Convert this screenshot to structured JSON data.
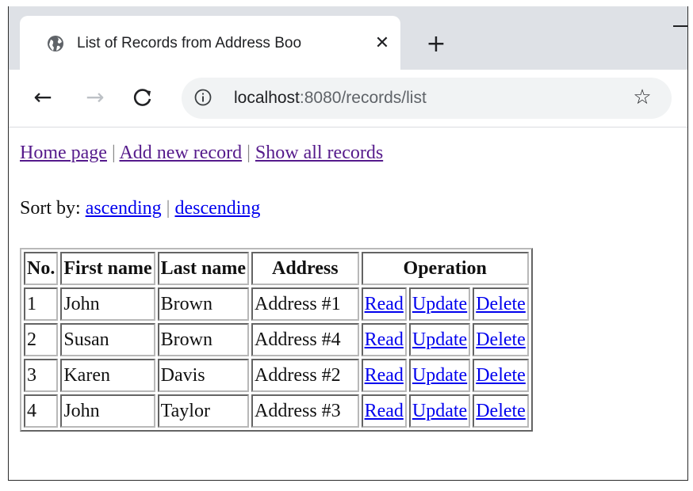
{
  "browser": {
    "tab_title": "List of Records from Address Boo",
    "tab_close": "✕",
    "new_tab": "+",
    "back": "←",
    "forward": "→",
    "reload": "C",
    "url_host": "localhost",
    "url_path": ":8080/records/list",
    "star": "☆",
    "favicon_icon": "globe-icon",
    "info_icon": "info-icon"
  },
  "nav": {
    "home": "Home page",
    "add": "Add new record",
    "show_all": "Show all records",
    "separator": "|"
  },
  "sort": {
    "label": "Sort by:",
    "ascending": "ascending",
    "descending": "descending",
    "separator": "|"
  },
  "table": {
    "headers": [
      "No.",
      "First name",
      "Last name",
      "Address",
      "Operation"
    ],
    "rows": [
      {
        "no": "1",
        "first": "John",
        "last": "Brown",
        "address": "Address #1",
        "read": "Read",
        "update": "Update",
        "delete": "Delete"
      },
      {
        "no": "2",
        "first": "Susan",
        "last": "Brown",
        "address": "Address #4",
        "read": "Read",
        "update": "Update",
        "delete": "Delete"
      },
      {
        "no": "3",
        "first": "Karen",
        "last": "Davis",
        "address": "Address #2",
        "read": "Read",
        "update": "Update",
        "delete": "Delete"
      },
      {
        "no": "4",
        "first": "John",
        "last": "Taylor",
        "address": "Address #3",
        "read": "Read",
        "update": "Update",
        "delete": "Delete"
      }
    ]
  },
  "colors": {
    "visited_link": "#551a8b",
    "link": "#0000ee",
    "tabstrip": "#dee1e6",
    "omnibox": "#f1f3f4"
  }
}
